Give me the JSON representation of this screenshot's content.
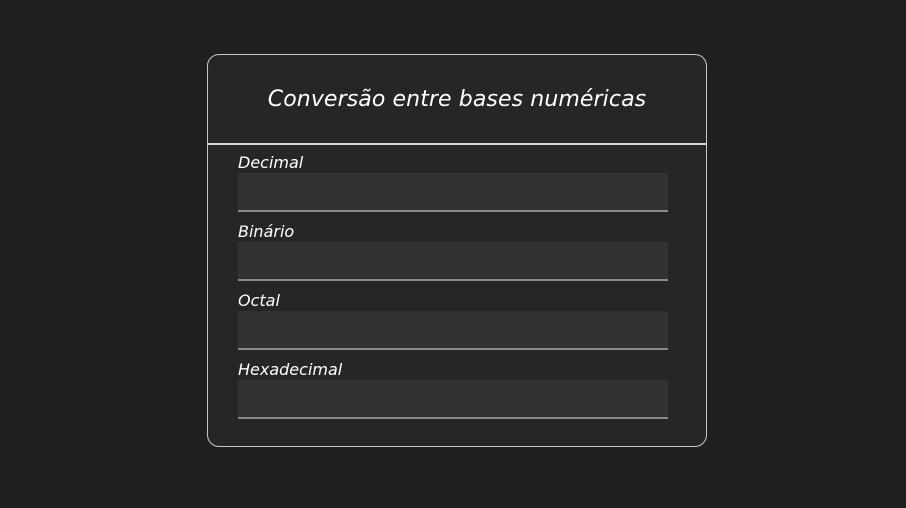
{
  "converter": {
    "title": "Conversão entre bases numéricas",
    "fields": [
      {
        "label": "Decimal",
        "value": ""
      },
      {
        "label": "Binário",
        "value": ""
      },
      {
        "label": "Octal",
        "value": ""
      },
      {
        "label": "Hexadecimal",
        "value": ""
      }
    ]
  },
  "colors": {
    "background": "#1f1f1f",
    "card": "#262626",
    "input": "#323232",
    "text": "#ffffff"
  }
}
